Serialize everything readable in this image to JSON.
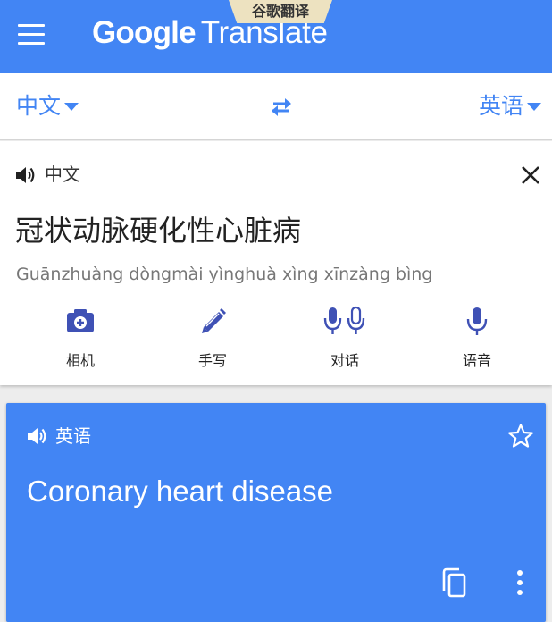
{
  "app_bar": {
    "title_brand": "Google",
    "title_product": "Translate",
    "ribbon": "谷歌翻译",
    "menu_icon": "hamburger-menu-icon",
    "color": "#4285f4"
  },
  "language_bar": {
    "source_language": "中文",
    "target_language": "英语",
    "swap_icon": "swap-arrows-icon",
    "accent_color": "#4285f4"
  },
  "input_card": {
    "language_label": "中文",
    "source_text": "冠状动脉硬化性心脏病",
    "romanization": "Guānzhuàng dòngmài yìnghuà xìng xīnzàng bìng",
    "speaker_icon": "speaker-icon",
    "clear_icon": "close-icon",
    "tools": [
      {
        "label": "相机",
        "icon": "camera-icon"
      },
      {
        "label": "手写",
        "icon": "pen-icon"
      },
      {
        "label": "对话",
        "icon": "conversation-mic-icon"
      },
      {
        "label": "语音",
        "icon": "mic-icon"
      }
    ]
  },
  "result_card": {
    "language_label": "英语",
    "translation": "Coronary heart disease",
    "speaker_icon": "speaker-icon",
    "star_icon": "star-outline-icon",
    "copy_icon": "copy-icon",
    "more_icon": "more-vert-icon",
    "color": "#4285f4"
  }
}
